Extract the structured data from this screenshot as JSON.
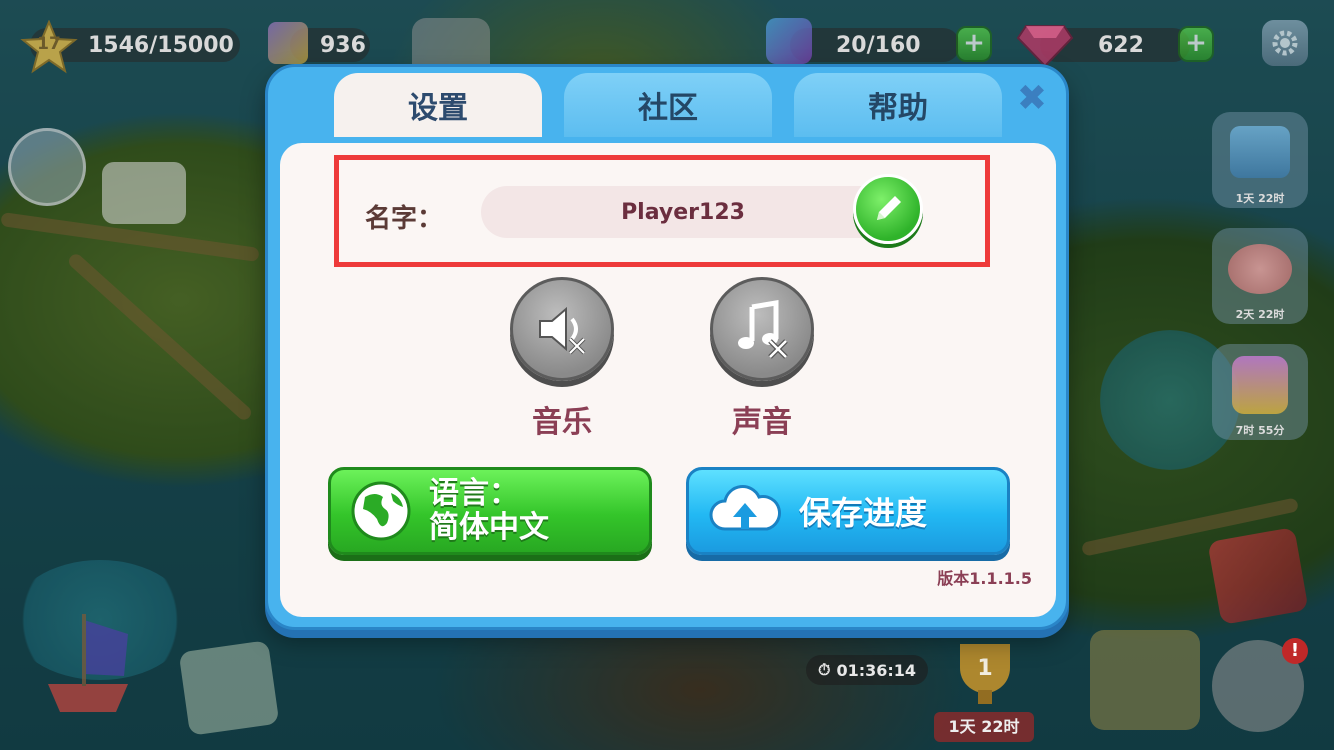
{
  "hud": {
    "level": "17",
    "xp": "1546/15000",
    "blocks": "936",
    "energy": "20/160",
    "gems": "622",
    "plus": "+"
  },
  "events": [
    {
      "name": "treasure-chest-event",
      "timer": "1天 22时"
    },
    {
      "name": "piggy-bank-event",
      "timer": "2天 22时"
    },
    {
      "name": "gem-trophy-event",
      "timer": "7时 55分"
    }
  ],
  "bottom": {
    "ship_timer": "01:36:14",
    "trophy_rank": "1",
    "trophy_timer": "1天 22时"
  },
  "dialog": {
    "tabs": [
      {
        "label": "设置",
        "active": true
      },
      {
        "label": "社区",
        "active": false
      },
      {
        "label": "帮助",
        "active": false
      }
    ],
    "close_label": "✖",
    "name_label": "名字：",
    "player_name": "Player123",
    "music_label": "音乐",
    "sound_label": "声音",
    "language_line1": "语言：",
    "language_line2": "简体中文",
    "save_label": "保存进度",
    "version": "版本1.1.1.5"
  },
  "colors": {
    "dialog_frame": "#48b3ee",
    "panel_bg": "#fbf6f4",
    "highlight_border": "#ee3a3a",
    "green_button": "#34c52a",
    "blue_button": "#22b8f3",
    "label_text": "#8b3f55"
  }
}
